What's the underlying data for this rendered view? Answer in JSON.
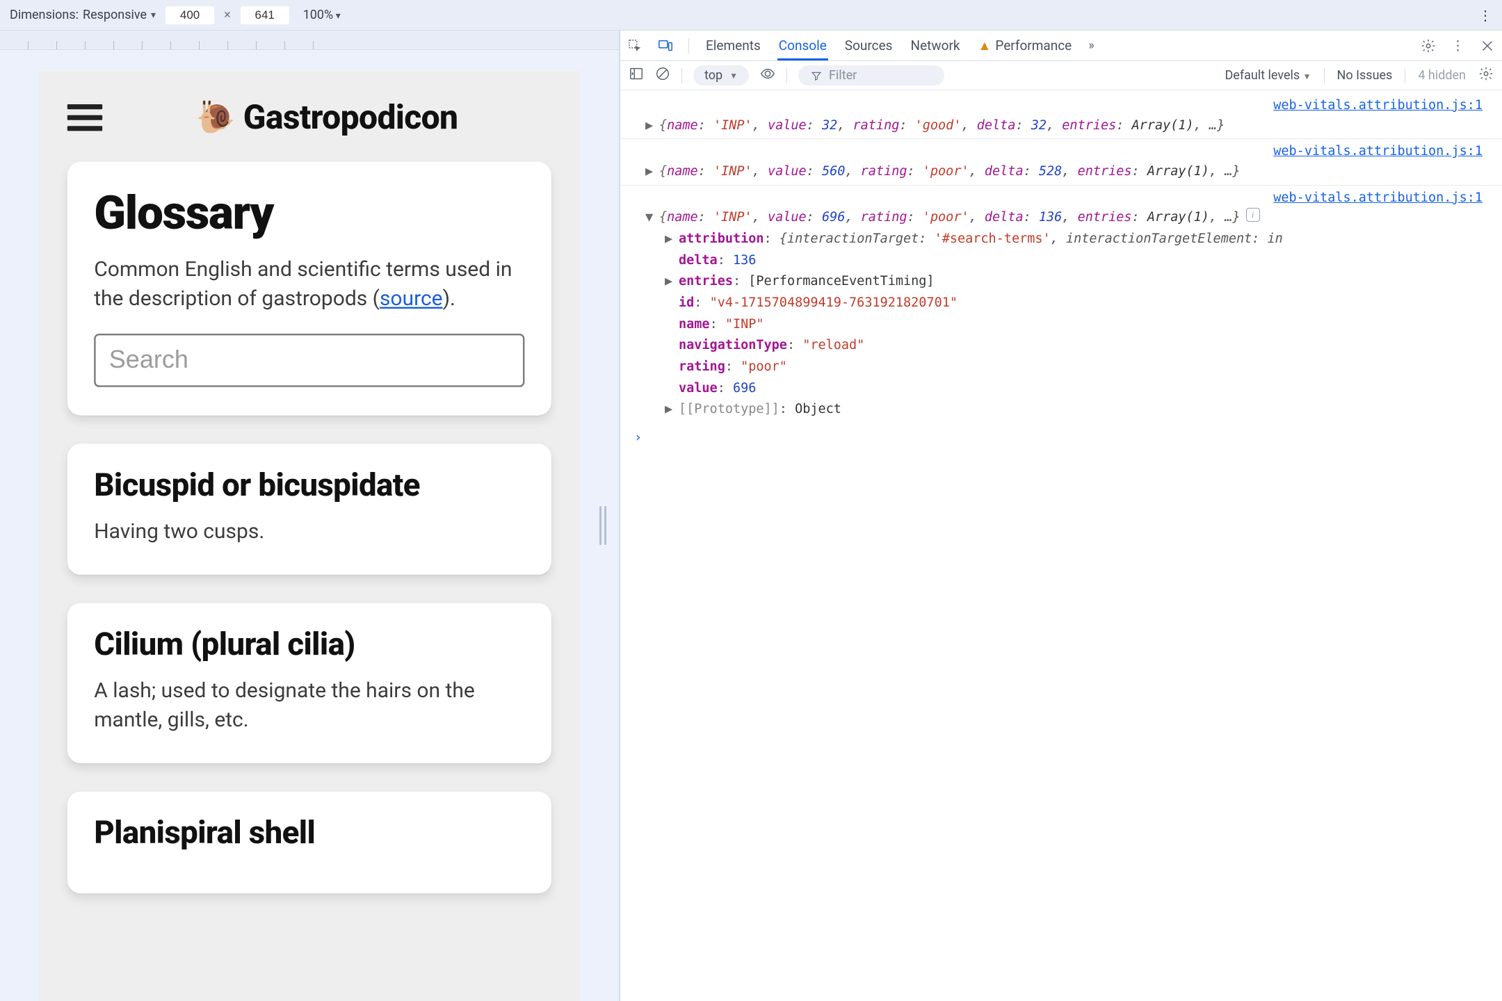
{
  "device_toolbar": {
    "dimensions_label": "Dimensions:",
    "device_name": "Responsive",
    "width": "400",
    "height": "641",
    "zoom": "100%"
  },
  "app": {
    "title": "Gastropodicon",
    "snail_emoji": "🐌",
    "glossary_heading": "Glossary",
    "glossary_desc_pre": "Common English and scientific terms used in the description of gastropods (",
    "glossary_desc_link": "source",
    "glossary_desc_post": ").",
    "search_placeholder": "Search",
    "entries": [
      {
        "term": "Bicuspid or bicuspidate",
        "def": "Having two cusps."
      },
      {
        "term": "Cilium (plural cilia)",
        "def": "A lash; used to designate the hairs on the mantle, gills, etc."
      },
      {
        "term": "Planispiral shell",
        "def": ""
      }
    ]
  },
  "devtools": {
    "tabs": {
      "elements": "Elements",
      "console": "Console",
      "sources": "Sources",
      "network": "Network",
      "performance": "Performance"
    },
    "subbar": {
      "context": "top",
      "filter_placeholder": "Filter",
      "levels": "Default levels",
      "issues": "No Issues",
      "hidden": "4 hidden"
    },
    "source_link": "web-vitals.attribution.js:1",
    "logs": [
      {
        "name": "INP",
        "value": 32,
        "rating": "good",
        "delta": 32,
        "entries": "Array(1)"
      },
      {
        "name": "INP",
        "value": 560,
        "rating": "poor",
        "delta": 528,
        "entries": "Array(1)"
      },
      {
        "name": "INP",
        "value": 696,
        "rating": "poor",
        "delta": 136,
        "entries": "Array(1)"
      }
    ],
    "expanded": {
      "attribution_target": "'#search-terms'",
      "attribution_tail": "interactionTargetElement:",
      "attribution_tail_val": "in",
      "delta": 136,
      "entries": "[PerformanceEventTiming]",
      "id": "\"v4-1715704899419-7631921820701\"",
      "name": "\"INP\"",
      "navigationType": "\"reload\"",
      "rating": "\"poor\"",
      "value": 696,
      "prototype": "Object"
    }
  }
}
